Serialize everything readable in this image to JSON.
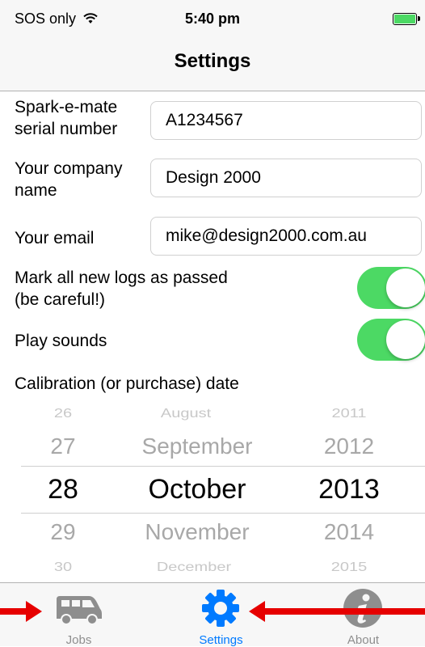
{
  "status_bar": {
    "carrier": "SOS only",
    "time": "5:40 pm"
  },
  "nav": {
    "title": "Settings"
  },
  "form": {
    "serial_label_1": "Spark-e-mate",
    "serial_label_2": "serial number",
    "serial_value": "A1234567",
    "company_label_1": "Your company",
    "company_label_2": "name",
    "company_value": "Design 2000",
    "email_label": "Your email",
    "email_value": "mike@design2000.com.au",
    "mark_passed_label_1": "Mark all new logs as passed",
    "mark_passed_label_2": "(be careful!)",
    "mark_passed_on": true,
    "play_sounds_label": "Play sounds",
    "play_sounds_on": true,
    "calibration_label": "Calibration (or purchase) date"
  },
  "date_picker": {
    "days": [
      "26",
      "27",
      "28",
      "29",
      "30"
    ],
    "months": [
      "August",
      "September",
      "October",
      "November",
      "December"
    ],
    "years": [
      "2011",
      "2012",
      "2013",
      "2014",
      "2015"
    ],
    "selected": {
      "day": "28",
      "month": "October",
      "year": "2013"
    }
  },
  "tabs": [
    {
      "label": "Jobs",
      "icon": "van-icon",
      "active": false
    },
    {
      "label": "Settings",
      "icon": "gear-icon",
      "active": true
    },
    {
      "label": "About",
      "icon": "info-icon",
      "active": false
    }
  ],
  "colors": {
    "accent": "#007aff",
    "toggle_on": "#4cd964",
    "arrow": "#e60000",
    "inactive_icon": "#8e8e8e"
  }
}
